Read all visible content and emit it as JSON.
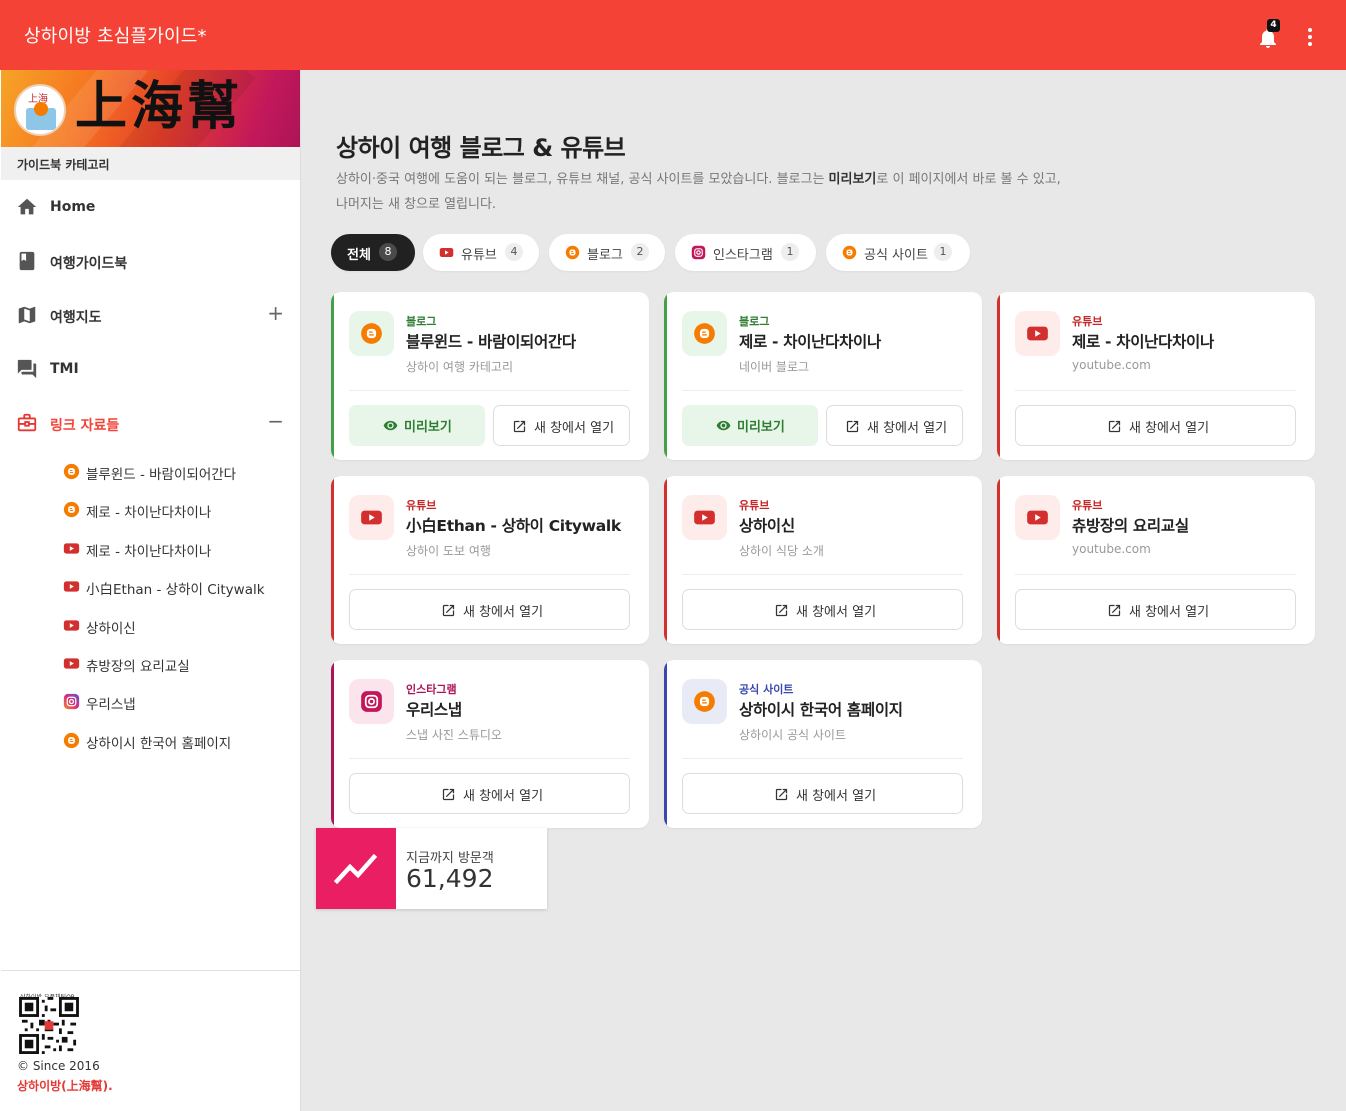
{
  "app": {
    "title": "상하이방 초심플가이드*",
    "notification_count": "4"
  },
  "colors": {
    "topbar": "#f44336",
    "accent_red": "#e53935",
    "green": "#2e7d32",
    "youtube": "#c62828",
    "blog": "#f57c00",
    "instagram": "#ad1457",
    "official": "#3949ab",
    "visitor": "#e91e63"
  },
  "sidebar": {
    "banner_brand": "上海幫",
    "banner_logo_text": "上海",
    "category_header": "가이드북 카테고리",
    "nav": [
      {
        "label": "Home",
        "icon": "home-icon",
        "expander": ""
      },
      {
        "label": "여행가이드북",
        "icon": "book-icon",
        "expander": ""
      },
      {
        "label": "여행지도",
        "icon": "map-icon",
        "expander": "+"
      },
      {
        "label": "TMI",
        "icon": "forum-icon",
        "expander": ""
      },
      {
        "label": "링크 자료들",
        "icon": "briefcase-icon",
        "expander": "−"
      }
    ],
    "links": [
      {
        "label": "블루윈드 - 바람이되어간다",
        "icon": "blogger-icon"
      },
      {
        "label": "제로 - 차이난다차이나",
        "icon": "blogger-icon"
      },
      {
        "label": "제로 - 차이난다차이나",
        "icon": "youtube-icon"
      },
      {
        "label": "小白Ethan - 상하이 Citywalk",
        "icon": "youtube-icon"
      },
      {
        "label": "상하이신",
        "icon": "youtube-icon"
      },
      {
        "label": "츄방장의 요리교실",
        "icon": "youtube-icon"
      },
      {
        "label": "우리스냅",
        "icon": "instagram-icon"
      },
      {
        "label": "상하이시 한국어 홈페이지",
        "icon": "blogger-icon"
      }
    ],
    "footer": {
      "qr_caption": "상하이방 오픈채팅QR",
      "since": "© Since 2016",
      "brand": "상하이방(上海幫)."
    }
  },
  "main": {
    "title": "상하이 여행 블로그 & 유튜브",
    "desc_line1_pre": "상하이·중국 여행에 도움이 되는 블로그, 유튜브 채널, 공식 사이트를 모았습니다. 블로그는 ",
    "desc_bold": "미리보기",
    "desc_line1_post": "로 이 페이지에서 바로 볼 수 있고,",
    "desc_line2": "나머지는 새 창으로 열립니다.",
    "filters": [
      {
        "label": "전체",
        "count": "8",
        "icon": ""
      },
      {
        "label": "유튜브",
        "count": "4",
        "icon": "youtube-icon"
      },
      {
        "label": "블로그",
        "count": "2",
        "icon": "blogger-icon"
      },
      {
        "label": "인스타그램",
        "count": "1",
        "icon": "instagram-icon"
      },
      {
        "label": "공식 사이트",
        "count": "1",
        "icon": "blogger-icon"
      }
    ],
    "cards": [
      {
        "tag": "블로그",
        "title": "블루윈드 - 바람이되어간다",
        "subtitle": "상하이 여행 카테고리",
        "kind": "blog",
        "preview": "미리보기",
        "open": "새 창에서 열기"
      },
      {
        "tag": "블로그",
        "title": "제로 - 차이난다차이나",
        "subtitle": "네이버 블로그",
        "kind": "blog",
        "preview": "미리보기",
        "open": "새 창에서 열기"
      },
      {
        "tag": "유튜브",
        "title": "제로 - 차이난다차이나",
        "subtitle": "youtube.com",
        "kind": "youtube",
        "open": "새 창에서 열기"
      },
      {
        "tag": "유튜브",
        "title": "小白Ethan - 상하이 Citywalk",
        "subtitle": "상하이 도보 여행",
        "kind": "youtube",
        "open": "새 창에서 열기"
      },
      {
        "tag": "유튜브",
        "title": "상하이신",
        "subtitle": "상하이 식당 소개",
        "kind": "youtube",
        "open": "새 창에서 열기"
      },
      {
        "tag": "유튜브",
        "title": "츄방장의 요리교실",
        "subtitle": "youtube.com",
        "kind": "youtube",
        "open": "새 창에서 열기"
      },
      {
        "tag": "인스타그램",
        "title": "우리스냅",
        "subtitle": "스냅 사진 스튜디오",
        "kind": "instagram",
        "open": "새 창에서 열기"
      },
      {
        "tag": "공식 사이트",
        "title": "상하이시 한국어 홈페이지",
        "subtitle": "상하이시 공식 사이트",
        "kind": "official",
        "open": "새 창에서 열기"
      }
    ],
    "visitor": {
      "label": "지금까지 방문객",
      "count": "61,492",
      "icon": "trending-up-icon"
    }
  }
}
